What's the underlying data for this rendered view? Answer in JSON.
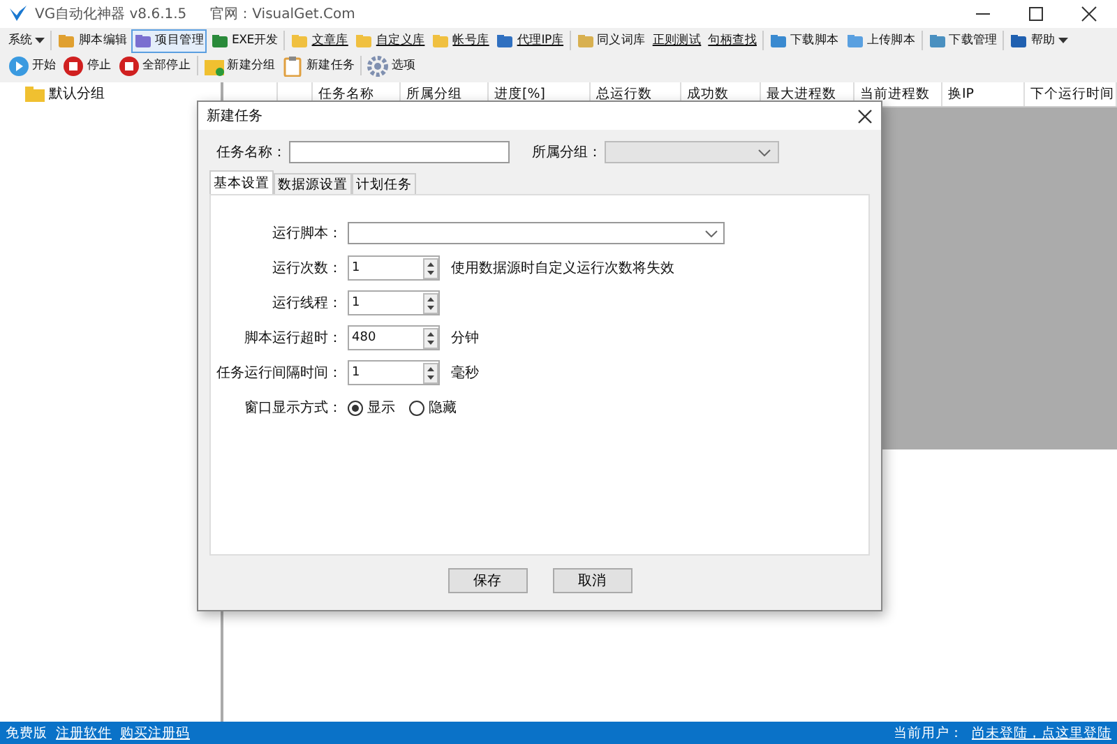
{
  "window": {
    "title": "VG自动化神器 v8.6.1.5",
    "site": "官网：VisualGet.Com"
  },
  "toolbar1": [
    {
      "label": "系统",
      "kind": "menu",
      "selected": false
    },
    {
      "label": "脚本编辑",
      "kind": "button",
      "selected": false
    },
    {
      "label": "项目管理",
      "kind": "button",
      "selected": true
    },
    {
      "label": "EXE开发",
      "kind": "button",
      "selected": false
    },
    {
      "label": "文章库",
      "kind": "link",
      "selected": false
    },
    {
      "label": "自定义库",
      "kind": "link",
      "selected": false
    },
    {
      "label": "帐号库",
      "kind": "link",
      "selected": false
    },
    {
      "label": "代理IP库",
      "kind": "link",
      "selected": false
    },
    {
      "label": "同义词库",
      "kind": "button",
      "selected": false
    },
    {
      "label": "正则测试",
      "kind": "link",
      "selected": false
    },
    {
      "label": "句柄查找",
      "kind": "link",
      "selected": false
    },
    {
      "label": "下载脚本",
      "kind": "button",
      "selected": false
    },
    {
      "label": "上传脚本",
      "kind": "button",
      "selected": false
    },
    {
      "label": "下载管理",
      "kind": "button",
      "selected": false
    },
    {
      "label": "帮助",
      "kind": "menu",
      "selected": false
    }
  ],
  "toolbar2": [
    "开始",
    "停止",
    "全部停止",
    "新建分组",
    "新建任务",
    "选项"
  ],
  "tree": {
    "items": [
      {
        "label": "默认分组"
      }
    ]
  },
  "table": {
    "columns": [
      "",
      "",
      "任务名称",
      "所属分组",
      "进度[%]",
      "总运行数",
      "成功数",
      "最大进程数",
      "当前进程数",
      "换IP",
      "下个运行时间"
    ]
  },
  "dialog": {
    "title": "新建任务",
    "name_label": "任务名称：",
    "group_label": "所属分组：",
    "tabs": [
      {
        "label": "基本设置",
        "selected": true
      },
      {
        "label": "数据源设置",
        "selected": false
      },
      {
        "label": "计划任务",
        "selected": false
      }
    ],
    "rows": [
      {
        "kind": "select",
        "label": "运行脚本："
      },
      {
        "kind": "spin",
        "label": "运行次数：",
        "value": "1",
        "note": "使用数据源时自定义运行次数将失效"
      },
      {
        "kind": "spin",
        "label": "运行线程：",
        "value": "1"
      },
      {
        "kind": "spin",
        "label": "脚本运行超时：",
        "value": "480",
        "note": "分钟"
      },
      {
        "kind": "spin",
        "label": "任务运行间隔时间：",
        "value": "1",
        "note": "毫秒"
      },
      {
        "kind": "radio",
        "label": "窗口显示方式：",
        "options": [
          {
            "label": "显示",
            "selected": true
          },
          {
            "label": "隐藏",
            "selected": false
          }
        ]
      }
    ],
    "buttons": [
      "保存",
      "取消"
    ]
  },
  "status_bar": {
    "edition": "免费版",
    "links": [
      "注册软件",
      "购买注册码"
    ],
    "user_label": "当前用户：",
    "login_link": "尚未登陆，点这里登陆"
  }
}
